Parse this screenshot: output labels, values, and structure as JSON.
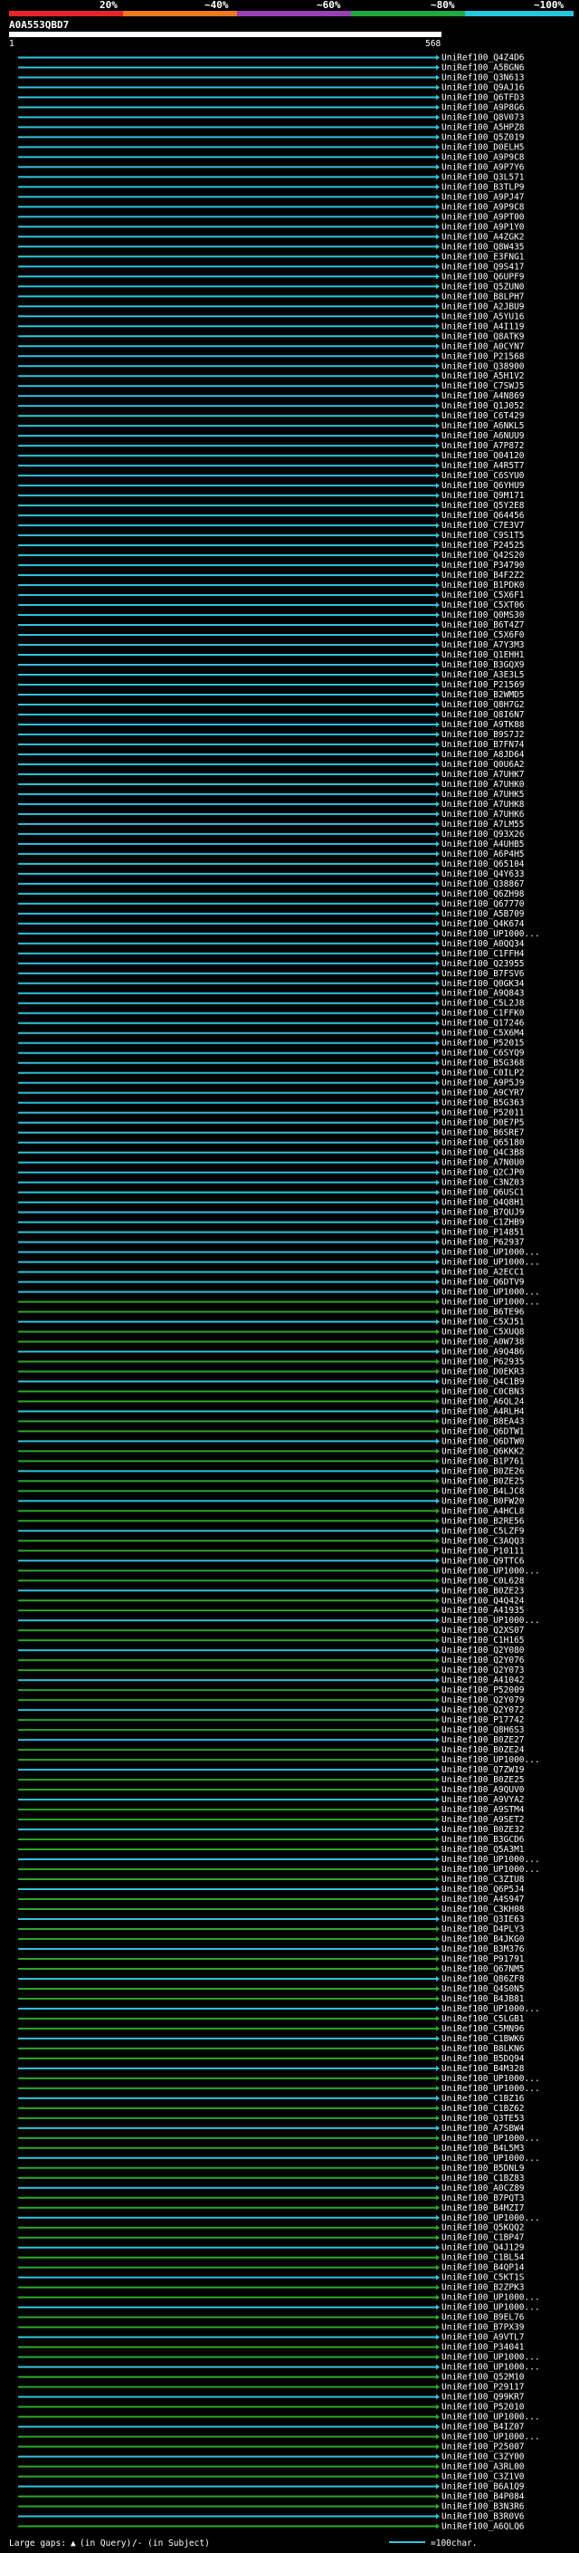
{
  "query_id": "A0A553QBD7",
  "query_range": {
    "start": "1",
    "end": "568"
  },
  "identity_scale": {
    "labels": [
      "20%",
      "~40%",
      "~60%",
      "~80%",
      "~100%"
    ],
    "colors": [
      "#e8242b",
      "#f07a1e",
      "#9b3fb5",
      "#22a83c",
      "#26c6e0"
    ]
  },
  "hit_colors": {
    "high": "#2cc6dc",
    "mid": "#2aa82a",
    "gap": "#222222",
    "bg_alt": "#0a1a24"
  },
  "legend": {
    "gaps_label": "Large gaps:",
    "query_gap_label": "(in Query)",
    "subject_gap_label": "/- (in Subject)",
    "line_label": "=100char."
  },
  "chart_data": {
    "type": "alignment-overview",
    "query_length": 568,
    "hit_ids": [
      "UniRef100_Q4Z4D6",
      "UniRef100_A5BGN6",
      "UniRef100_Q3N613",
      "UniRef100_Q9AJ16",
      "UniRef100_Q6TFD3",
      "UniRef100_A9P8G6",
      "UniRef100_Q8V073",
      "UniRef100_A5HPZ8",
      "UniRef100_Q5Z019",
      "UniRef100_D0ELH5",
      "UniRef100_A9P9C8",
      "UniRef100_A9P7Y6",
      "UniRef100_Q3L571",
      "UniRef100_B3TLP9",
      "UniRef100_A9PJ47",
      "UniRef100_A9P9C8",
      "UniRef100_A9PT00",
      "UniRef100_A9P1Y0",
      "UniRef100_A4ZGK2",
      "UniRef100_Q8W435",
      "UniRef100_E3FNG1",
      "UniRef100_Q9S417",
      "UniRef100_Q6UPF9",
      "UniRef100_Q5ZUN0",
      "UniRef100_B8LPH7",
      "UniRef100_A2JBU9",
      "UniRef100_A5YU16",
      "UniRef100_A4I119",
      "UniRef100_Q8ATK9",
      "UniRef100_A0CYN7",
      "UniRef100_P21568",
      "UniRef100_Q38900",
      "UniRef100_A5H1V2",
      "UniRef100_C7SWJ5",
      "UniRef100_A4N869",
      "UniRef100_Q1J052",
      "UniRef100_C6T429",
      "UniRef100_A6NKL5",
      "UniRef100_A6NUU9",
      "UniRef100_A7P872",
      "UniRef100_Q04120",
      "UniRef100_A4R5T7",
      "UniRef100_C6SYU0",
      "UniRef100_Q6YHU9",
      "UniRef100_Q9M171",
      "UniRef100_Q5Y2E8",
      "UniRef100_Q64456",
      "UniRef100_C7E3V7",
      "UniRef100_C9S1T5",
      "UniRef100_P24525",
      "UniRef100_Q42S20",
      "UniRef100_P34790",
      "UniRef100_B4F2Z2",
      "UniRef100_B1PDK0",
      "UniRef100_C5X6F1",
      "UniRef100_C5XT06",
      "UniRef100_Q0MS30",
      "UniRef100_B6T4Z7",
      "UniRef100_C5X6F0",
      "UniRef100_A7Y3M3",
      "UniRef100_Q1EHH1",
      "UniRef100_B3GQX9",
      "UniRef100_A3E3L5",
      "UniRef100_P21569",
      "UniRef100_B2WMD5",
      "UniRef100_Q8H7G2",
      "UniRef100_Q8I6N7",
      "UniRef100_A9TK88",
      "UniRef100_B9S7J2",
      "UniRef100_B7FN74",
      "UniRef100_A8JD64",
      "UniRef100_Q0U6A2",
      "UniRef100_A7UHK7",
      "UniRef100_A7UHK0",
      "UniRef100_A7UHK5",
      "UniRef100_A7UHK8",
      "UniRef100_A7UHK6",
      "UniRef100_A7LM55",
      "UniRef100_Q93X26",
      "UniRef100_A4UHB5",
      "UniRef100_A6P4H5",
      "UniRef100_Q65104",
      "UniRef100_Q4Y633",
      "UniRef100_Q38867",
      "UniRef100_Q6ZH98",
      "UniRef100_Q67770",
      "UniRef100_A5B709",
      "UniRef100_Q4K674",
      "UniRef100_UP1000...",
      "UniRef100_A0QQ34",
      "UniRef100_C1FFH4",
      "UniRef100_Q23955",
      "UniRef100_B7FSV6",
      "UniRef100_Q0GK34",
      "UniRef100_A9Q843",
      "UniRef100_C5L2J8",
      "UniRef100_C1FFK0",
      "UniRef100_Q17246",
      "UniRef100_C5X6M4",
      "UniRef100_P52015",
      "UniRef100_C6SYQ9",
      "UniRef100_B5G368",
      "UniRef100_C0ILP2",
      "UniRef100_A9P5J9",
      "UniRef100_A9CYR7",
      "UniRef100_B5G363",
      "UniRef100_P52011",
      "UniRef100_D0E7P5",
      "UniRef100_B6SRE7",
      "UniRef100_Q65180",
      "UniRef100_Q4C3B8",
      "UniRef100_A7N0U0",
      "UniRef100_Q2CJP0",
      "UniRef100_C3NZ03",
      "UniRef100_Q6USC1",
      "UniRef100_Q4Q8H1",
      "UniRef100_B7QUJ9",
      "UniRef100_C1ZHB9",
      "UniRef100_P14851",
      "UniRef100_P62937",
      "UniRef100_UP1000...",
      "UniRef100_UP1000...",
      "UniRef100_A2ECC1",
      "UniRef100_Q6DTV9",
      "UniRef100_UP1000...",
      "UniRef100_UP1000...",
      "UniRef100_B6TE96",
      "UniRef100_C5XJ51",
      "UniRef100_C5XUQ8",
      "UniRef100_A0W738",
      "UniRef100_A9Q486",
      "UniRef100_P62935",
      "UniRef100_D0EKR3",
      "UniRef100_Q4C1B9",
      "UniRef100_C0CBN3",
      "UniRef100_A6QL24",
      "UniRef100_A4RLH4",
      "UniRef100_B8EA43",
      "UniRef100_Q6DTW1",
      "UniRef100_Q6DTW0",
      "UniRef100_Q6KKK2",
      "UniRef100_B1P761",
      "UniRef100_B0ZE26",
      "UniRef100_B0ZE25",
      "UniRef100_B4LJC8",
      "UniRef100_B0FW20",
      "UniRef100_A4HCL8",
      "UniRef100_B2RE56",
      "UniRef100_C5LZF9",
      "UniRef100_C3AQQ3",
      "UniRef100_P10111",
      "UniRef100_Q9TTC6",
      "UniRef100_UP1000...",
      "UniRef100_C0L628",
      "UniRef100_B0ZE23",
      "UniRef100_Q4Q424",
      "UniRef100_A41935",
      "UniRef100_UP1000...",
      "UniRef100_Q2XS07",
      "UniRef100_C1H165",
      "UniRef100_Q2Y080",
      "UniRef100_Q2Y076",
      "UniRef100_Q2Y073",
      "UniRef100_A41042",
      "UniRef100_P52009",
      "UniRef100_Q2Y079",
      "UniRef100_Q2Y072",
      "UniRef100_P17742",
      "UniRef100_Q8H6S3",
      "UniRef100_B0ZE27",
      "UniRef100_B0ZE24",
      "UniRef100_UP1000...",
      "UniRef100_Q7ZW19",
      "UniRef100_B0ZE25",
      "UniRef100_A9QUV0",
      "UniRef100_A9VYA2",
      "UniRef100_A9STM4",
      "UniRef100_A9SET2",
      "UniRef100_B0ZE32",
      "UniRef100_B3GCD6",
      "UniRef100_Q5A3M1",
      "UniRef100_UP1000...",
      "UniRef100_UP1000...",
      "UniRef100_C3ZIU8",
      "UniRef100_Q6P5J4",
      "UniRef100_A4S947",
      "UniRef100_C3KH08",
      "UniRef100_Q3IE63",
      "UniRef100_D4PLY3",
      "UniRef100_B4JKG0",
      "UniRef100_B3M376",
      "UniRef100_P91791",
      "UniRef100_Q67NM5",
      "UniRef100_Q86ZF8",
      "UniRef100_Q4S0N5",
      "UniRef100_B4JB81",
      "UniRef100_UP1000...",
      "UniRef100_C5LGB1",
      "UniRef100_C5MN96",
      "UniRef100_C1BWK6",
      "UniRef100_B8LKN6",
      "UniRef100_B5DQ94",
      "UniRef100_B4M328",
      "UniRef100_UP1000...",
      "UniRef100_UP1000...",
      "UniRef100_C1BZ16",
      "UniRef100_C1BZ62",
      "UniRef100_Q3TE53",
      "UniRef100_A7SBW4",
      "UniRef100_UP1000...",
      "UniRef100_B4L5M3",
      "UniRef100_UP1000...",
      "UniRef100_B5DNL9",
      "UniRef100_C1BZ83",
      "UniRef100_A0CZ89",
      "UniRef100_B7PQT3",
      "UniRef100_B4MZI7",
      "UniRef100_UP1000...",
      "UniRef100_Q5KQQ2",
      "UniRef100_C1BP47",
      "UniRef100_Q4J129",
      "UniRef100_C1BL54",
      "UniRef100_B4QP14",
      "UniRef100_C5KT1S",
      "UniRef100_B2ZPK3",
      "UniRef100_UP1000...",
      "UniRef100_UP1000...",
      "UniRef100_B9EL76",
      "UniRef100_B7PX39",
      "UniRef100_A9VTL7",
      "UniRef100_P34041",
      "UniRef100_UP1000...",
      "UniRef100_UP1000...",
      "UniRef100_Q52M10",
      "UniRef100_P29117",
      "UniRef100_Q99KR7",
      "UniRef100_P52010",
      "UniRef100_UP1000...",
      "UniRef100_B4IZ07",
      "UniRef100_UP1000...",
      "UniRef100_P25007",
      "UniRef100_C3ZY00",
      "UniRef100_A3RL00",
      "UniRef100_C3Z1V0",
      "UniRef100_B6A1Q9",
      "UniRef100_B4P084",
      "UniRef100_B3N3R6",
      "UniRef100_B3R0V6",
      "UniRef100_A6QLQ6"
    ]
  }
}
